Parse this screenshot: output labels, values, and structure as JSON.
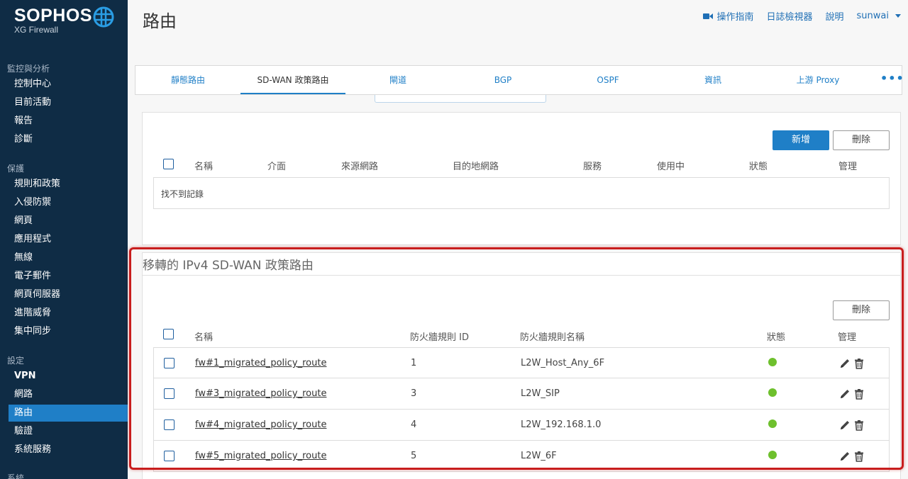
{
  "brand": {
    "name": "SOPHOS",
    "subtitle": "XG Firewall"
  },
  "sidebar": {
    "sections": [
      {
        "title": "監控與分析",
        "items": [
          "控制中心",
          "目前活動",
          "報告",
          "診斷"
        ]
      },
      {
        "title": "保護",
        "items": [
          "規則和政策",
          "入侵防禦",
          "網頁",
          "應用程式",
          "無線",
          "電子郵件",
          "網頁伺服器",
          "進階威脅",
          "集中同步"
        ]
      },
      {
        "title": "設定",
        "items": [
          "VPN",
          "網路",
          "路由",
          "驗證",
          "系統服務"
        ]
      },
      {
        "title": "系統",
        "items": []
      }
    ],
    "active_item": "路由"
  },
  "header": {
    "title": "路由",
    "links": {
      "guide": "操作指南",
      "log_viewer": "日誌檢視器",
      "help": "說明",
      "user": "sunwai"
    }
  },
  "tabs": [
    "靜態路由",
    "SD-WAN 政策路由",
    "閘道",
    "BGP",
    "OSPF",
    "資訊",
    "上游 Proxy"
  ],
  "active_tab": "SD-WAN 政策路由",
  "policy_table": {
    "add_label": "新增",
    "delete_label": "刪除",
    "columns": [
      "名稱",
      "介面",
      "來源網路",
      "目的地網路",
      "服務",
      "使用中",
      "狀態",
      "管理"
    ],
    "empty_text": "找不到記錄"
  },
  "migrated": {
    "heading": "移轉的 IPv4 SD-WAN 政策路由",
    "delete_label": "刪除",
    "columns": [
      "名稱",
      "防火牆規則 ID",
      "防火牆規則名稱",
      "狀態",
      "管理"
    ],
    "rows": [
      {
        "name": "fw#1_migrated_policy_route",
        "rule_id": "1",
        "rule_name": "L2W_Host_Any_6F"
      },
      {
        "name": "fw#3_migrated_policy_route",
        "rule_id": "3",
        "rule_name": "L2W_SIP"
      },
      {
        "name": "fw#4_migrated_policy_route",
        "rule_id": "4",
        "rule_name": "L2W_192.168.1.0"
      },
      {
        "name": "fw#5_migrated_policy_route",
        "rule_id": "5",
        "rule_name": "L2W_6F"
      }
    ]
  },
  "colors": {
    "sidebar_bg": "#0f2c45",
    "accent": "#1f7fc7",
    "status_active": "#6ec02d",
    "highlight": "#c81e1e"
  },
  "icons": [
    "video-camera-icon",
    "pencil-icon",
    "trash-icon",
    "more-dots-icon",
    "globe-logo-icon"
  ]
}
